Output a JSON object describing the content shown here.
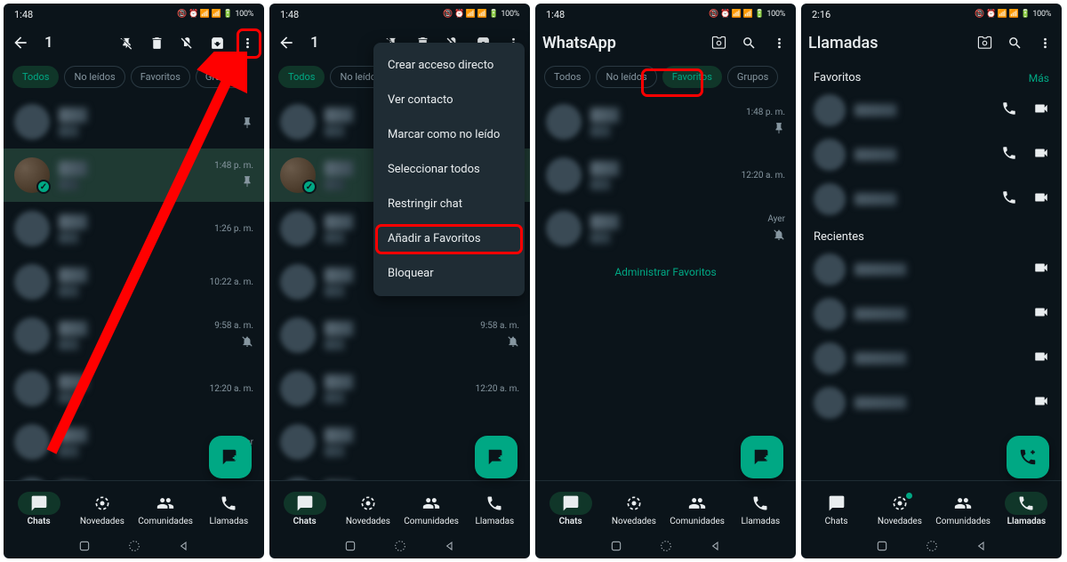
{
  "status": {
    "time_a": "1:48",
    "time_b": "2:16",
    "battery": "100%",
    "indicators": "⚡ 📶 📶 ⏰"
  },
  "selection": {
    "count": "1"
  },
  "filters": {
    "all": "Todos",
    "unread": "No leídos",
    "favorites": "Favoritos",
    "groups": "Grupos"
  },
  "screen3": {
    "title": "WhatsApp",
    "manage": "Administrar Favoritos"
  },
  "screen4": {
    "title": "Llamadas",
    "favorites": "Favoritos",
    "more": "Más",
    "recent": "Recientes"
  },
  "menu": {
    "shortcut": "Crear acceso directo",
    "view_contact": "Ver contacto",
    "mark_unread": "Marcar como no leído",
    "select_all": "Seleccionar todos",
    "restrict": "Restringir chat",
    "add_favorites": "Añadir a Favoritos",
    "block": "Bloquear"
  },
  "nav": {
    "chats": "Chats",
    "updates": "Novedades",
    "communities": "Comunidades",
    "calls": "Llamadas"
  },
  "times": {
    "t1": "1:48 p. m.",
    "t2": "1:26 p. m.",
    "t3": "10:22 a. m.",
    "t4": "9:58 a. m.",
    "t5": "12:20 a. m.",
    "t6": "Ayer",
    "s3_t1": "1:48 p. m.",
    "s3_t2": "12:20 a. m.",
    "s3_t3": "Ayer"
  }
}
